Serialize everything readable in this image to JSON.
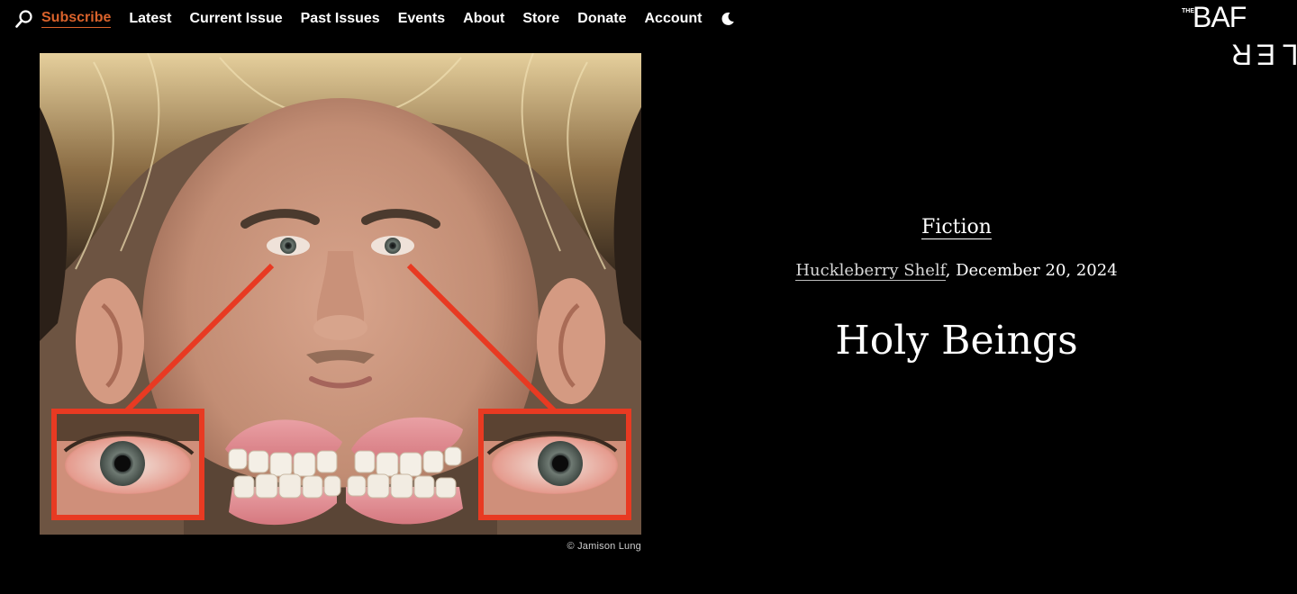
{
  "nav": {
    "search_icon": "search-icon",
    "items": [
      {
        "label": "Subscribe",
        "highlight": true,
        "color": "#d9622b"
      },
      {
        "label": "Latest"
      },
      {
        "label": "Current Issue"
      },
      {
        "label": "Past Issues"
      },
      {
        "label": "Events"
      },
      {
        "label": "About"
      },
      {
        "label": "Store"
      },
      {
        "label": "Donate"
      },
      {
        "label": "Account"
      }
    ],
    "theme_icon": "moon-icon"
  },
  "logo": {
    "the": "THE",
    "baf": "BAF",
    "fler": "FLER"
  },
  "hero": {
    "credit": "© Jamison Lung",
    "accent_color": "#e83a22"
  },
  "article": {
    "section": "Fiction",
    "author": "Huckleberry Shelf",
    "date": ", December 20, 2024",
    "title": "Holy Beings"
  }
}
